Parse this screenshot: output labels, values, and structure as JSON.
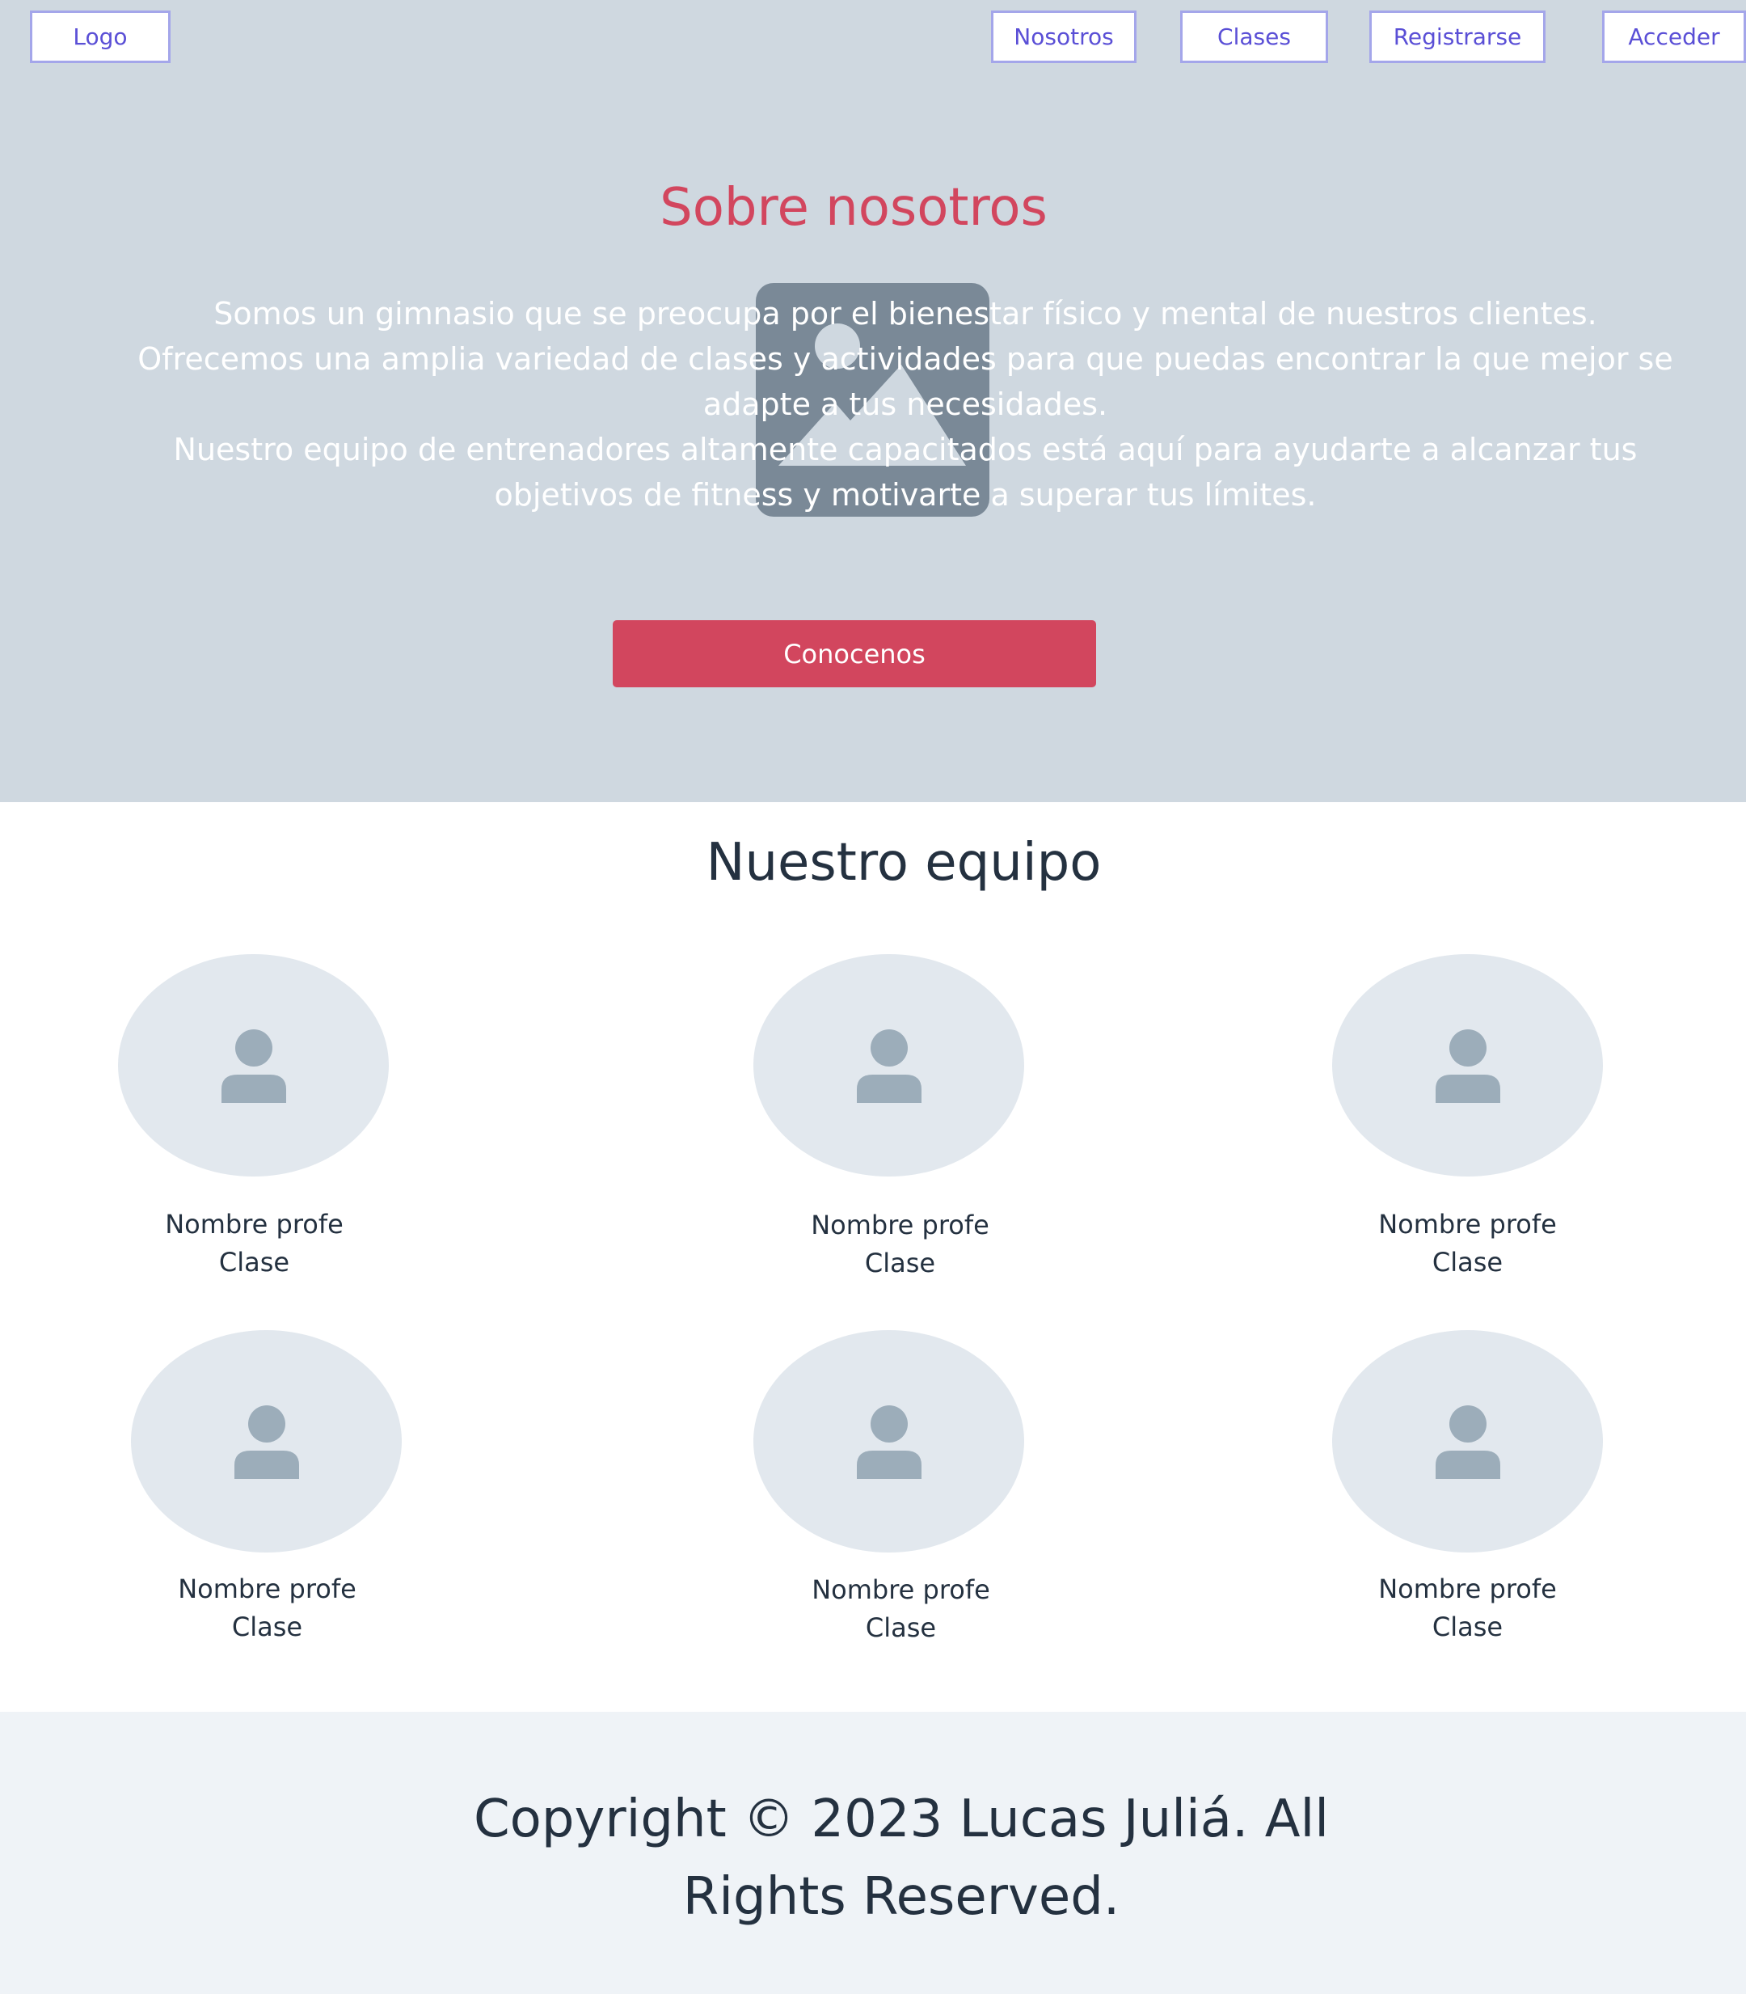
{
  "nav": {
    "logo": "Logo",
    "items": [
      "Nosotros",
      "Clases",
      "Registrarse",
      "Acceder"
    ]
  },
  "hero": {
    "title": "Sobre nosotros",
    "paragraph1": "Somos un gimnasio que se preocupa por el bienestar físico y mental de nuestros clientes. Ofrecemos una amplia variedad de clases y actividades para que puedas encontrar la que mejor se adapte a tus necesidades.",
    "paragraph2": "Nuestro equipo de entrenadores altamente capacitados está aquí para ayudarte a alcanzar tus objetivos de fitness y motivarte a superar tus límites.",
    "button": "Conocenos",
    "image_icon": "image-placeholder-icon"
  },
  "team": {
    "title": "Nuestro equipo",
    "members": [
      {
        "name": "Nombre profe",
        "class": "Clase"
      },
      {
        "name": "Nombre profe",
        "class": "Clase"
      },
      {
        "name": "Nombre profe",
        "class": "Clase"
      },
      {
        "name": "Nombre profe",
        "class": "Clase"
      },
      {
        "name": "Nombre profe",
        "class": "Clase"
      },
      {
        "name": "Nombre profe",
        "class": "Clase"
      }
    ],
    "avatar_icon": "user-icon"
  },
  "footer": {
    "copyright": "Copyright © 2023 Lucas Juliá. All Rights Reserved."
  },
  "colors": {
    "hero_bg": "#cfd8e0",
    "accent": "#d2465e",
    "nav_border": "#a4a6ea",
    "nav_text": "#5a4fd6",
    "footer_bg": "#eff3f7",
    "text_dark": "#243140"
  }
}
